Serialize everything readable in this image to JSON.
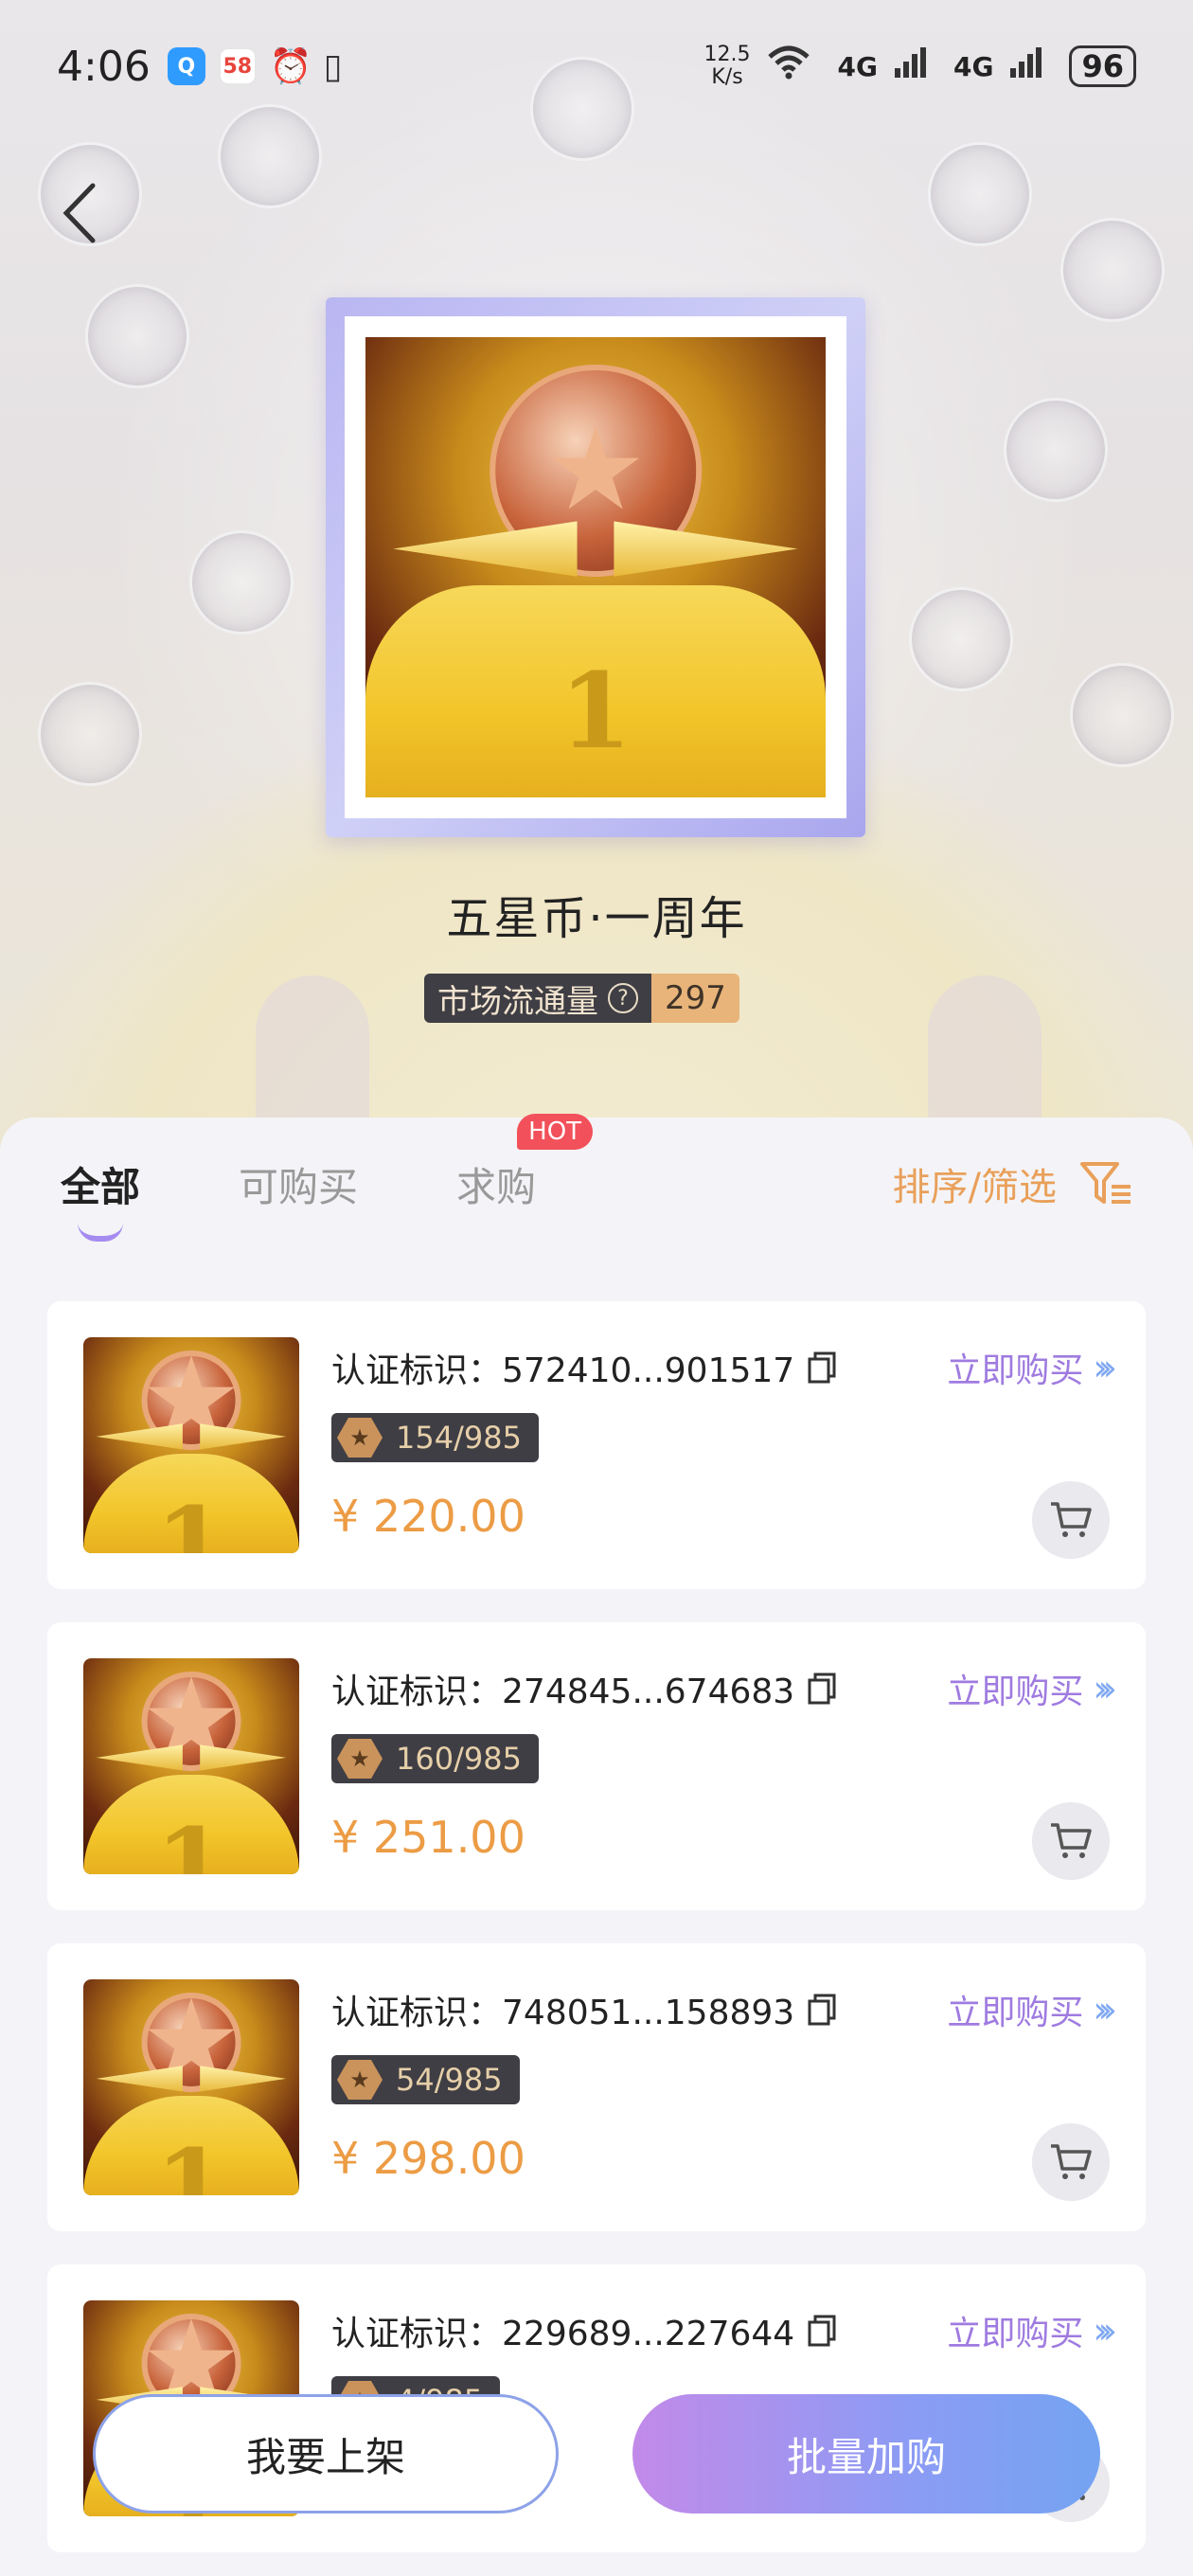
{
  "status_bar": {
    "time": "4:06",
    "apps": [
      "Q",
      "58"
    ],
    "net_speed_value": "12.5",
    "net_speed_unit": "K/s",
    "signal_1": "4G",
    "signal_2": "4G",
    "battery": "96"
  },
  "item": {
    "title": "五星币·一周年",
    "circulation_label": "市场流通量",
    "circulation_value": "297"
  },
  "tabs": [
    {
      "label": "全部",
      "active": true
    },
    {
      "label": "可购买",
      "active": false
    },
    {
      "label": "求购",
      "active": false,
      "badge": "HOT"
    }
  ],
  "sort_filter_label": "排序/筛选",
  "listings": [
    {
      "id_label": "认证标识：",
      "id": "572410...901517",
      "edition": "154/985",
      "price": "¥ 220.00",
      "buy_label": "立即购买"
    },
    {
      "id_label": "认证标识：",
      "id": "274845...674683",
      "edition": "160/985",
      "price": "¥ 251.00",
      "buy_label": "立即购买"
    },
    {
      "id_label": "认证标识：",
      "id": "748051...158893",
      "edition": "54/985",
      "price": "¥ 298.00",
      "buy_label": "立即购买"
    },
    {
      "id_label": "认证标识：",
      "id": "229689...227644",
      "edition": "4/985",
      "price": "",
      "buy_label": "立即购买"
    }
  ],
  "actions": {
    "list_item": "我要上架",
    "bulk_buy": "批量加购"
  },
  "colors": {
    "accent_purple": "#9f7be0",
    "price_orange": "#ec9c45",
    "hot_red": "#f2505a"
  }
}
